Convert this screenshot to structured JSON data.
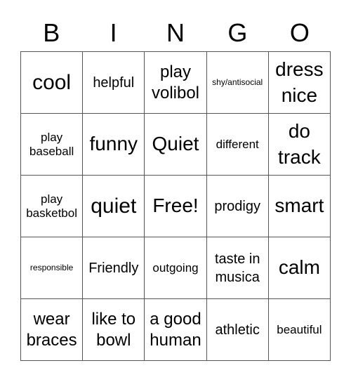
{
  "header": [
    "B",
    "I",
    "N",
    "G",
    "O"
  ],
  "cells": [
    {
      "text": "cool",
      "size": "s-xl"
    },
    {
      "text": "helpful",
      "size": "s-m"
    },
    {
      "text": "play volibol",
      "size": "s-ml"
    },
    {
      "text": "shy/antisocial",
      "size": "s-xs"
    },
    {
      "text": "dress nice",
      "size": "s-l"
    },
    {
      "text": "play baseball",
      "size": "s-sm"
    },
    {
      "text": "funny",
      "size": "s-l"
    },
    {
      "text": "Quiet",
      "size": "s-l"
    },
    {
      "text": "different",
      "size": "s-sm"
    },
    {
      "text": "do track",
      "size": "s-l"
    },
    {
      "text": "play basketbol",
      "size": "s-sm"
    },
    {
      "text": "quiet",
      "size": "s-xl"
    },
    {
      "text": "Free!",
      "size": "s-l"
    },
    {
      "text": "prodigy",
      "size": "s-m"
    },
    {
      "text": "smart",
      "size": "s-l"
    },
    {
      "text": "responsible",
      "size": "s-xs"
    },
    {
      "text": "Friendly",
      "size": "s-m"
    },
    {
      "text": "outgoing",
      "size": "s-sm"
    },
    {
      "text": "taste in musica",
      "size": "s-m"
    },
    {
      "text": "calm",
      "size": "s-l"
    },
    {
      "text": "wear braces",
      "size": "s-ml"
    },
    {
      "text": "like to bowl",
      "size": "s-ml"
    },
    {
      "text": "a good human",
      "size": "s-ml"
    },
    {
      "text": "athletic",
      "size": "s-m"
    },
    {
      "text": "beautiful",
      "size": "s-sm"
    }
  ]
}
